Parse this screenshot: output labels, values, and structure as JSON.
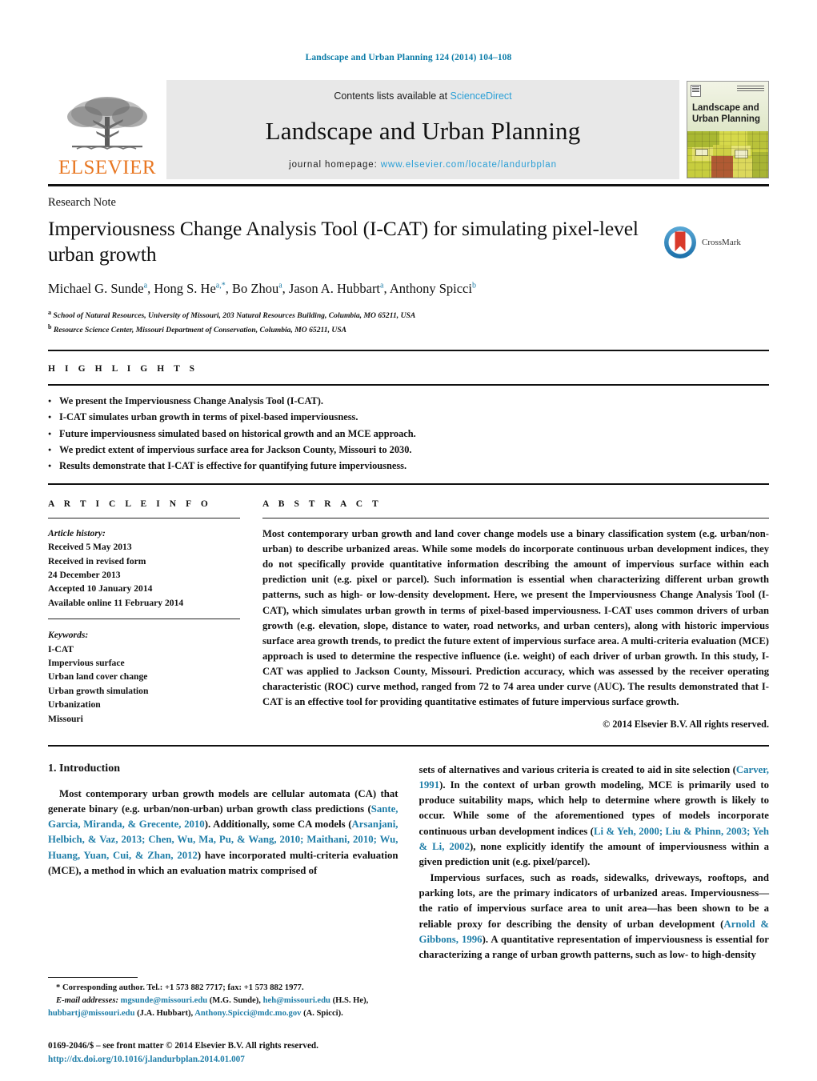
{
  "running_head": "Landscape and Urban Planning 124 (2014) 104–108",
  "masthead": {
    "elsevier_wordmark": "ELSEVIER",
    "contents_prefix": "Contents lists available at ",
    "contents_link": "ScienceDirect",
    "journal_title": "Landscape and Urban Planning",
    "homepage_prefix": "journal homepage: ",
    "homepage_url": "www.elsevier.com/locate/landurbplan",
    "cover_title_line1": "Landscape and",
    "cover_title_line2": "Urban Planning"
  },
  "article": {
    "doctype": "Research Note",
    "title": "Imperviousness Change Analysis Tool (I-CAT) for simulating pixel-level urban growth",
    "crossmark_label": "CrossMark",
    "authors": [
      {
        "name": "Michael G. Sunde",
        "marks": "a",
        "sep": ", "
      },
      {
        "name": "Hong S. He",
        "marks": "a,*",
        "sep": ", "
      },
      {
        "name": "Bo Zhou",
        "marks": "a",
        "sep": ", "
      },
      {
        "name": "Jason A. Hubbart",
        "marks": "a",
        "sep": ", "
      },
      {
        "name": "Anthony Spicci",
        "marks": "b",
        "sep": ""
      }
    ],
    "affiliations": [
      {
        "mark": "a",
        "text": "School of Natural Resources, University of Missouri, 203 Natural Resources Building, Columbia, MO 65211, USA"
      },
      {
        "mark": "b",
        "text": "Resource Science Center, Missouri Department of Conservation, Columbia, MO 65211, USA"
      }
    ]
  },
  "highlights": {
    "label": "H I G H L I G H T S",
    "items": [
      "We present the Imperviousness Change Analysis Tool (I-CAT).",
      "I-CAT simulates urban growth in terms of pixel-based imperviousness.",
      "Future imperviousness simulated based on historical growth and an MCE approach.",
      "We predict extent of impervious surface area for Jackson County, Missouri to 2030.",
      "Results demonstrate that I-CAT is effective for quantifying future imperviousness."
    ]
  },
  "article_info": {
    "label": "A R T I C L E    I N F O",
    "history_label": "Article history:",
    "history": [
      "Received 5 May 2013",
      "Received in revised form",
      "24 December 2013",
      "Accepted 10 January 2014",
      "Available online 11 February 2014"
    ],
    "keywords_label": "Keywords:",
    "keywords": [
      "I-CAT",
      "Impervious surface",
      "Urban land cover change",
      "Urban growth simulation",
      "Urbanization",
      "Missouri"
    ]
  },
  "abstract": {
    "label": "A B S T R A C T",
    "text": "Most contemporary urban growth and land cover change models use a binary classification system (e.g. urban/non-urban) to describe urbanized areas. While some models do incorporate continuous urban development indices, they do not specifically provide quantitative information describing the amount of impervious surface within each prediction unit (e.g. pixel or parcel). Such information is essential when characterizing different urban growth patterns, such as high- or low-density development. Here, we present the Imperviousness Change Analysis Tool (I-CAT), which simulates urban growth in terms of pixel-based imperviousness. I-CAT uses common drivers of urban growth (e.g. elevation, slope, distance to water, road networks, and urban centers), along with historic impervious surface area growth trends, to predict the future extent of impervious surface area. A multi-criteria evaluation (MCE) approach is used to determine the respective influence (i.e. weight) of each driver of urban growth. In this study, I-CAT was applied to Jackson County, Missouri. Prediction accuracy, which was assessed by the receiver operating characteristic (ROC) curve method, ranged from 72 to 74 area under curve (AUC). The results demonstrated that I-CAT is an effective tool for providing quantitative estimates of future impervious surface growth.",
    "copyright": "© 2014 Elsevier B.V. All rights reserved."
  },
  "intro": {
    "section_title": "1.  Introduction",
    "left_p1_a": "Most contemporary urban growth models are cellular automata (CA) that generate binary (e.g. urban/non-urban) urban growth class predictions (",
    "left_p1_cite1": "Sante, Garcia, Miranda, & Grecente, 2010",
    "left_p1_b": "). Additionally, some CA models (",
    "left_p1_cite2": "Arsanjani, Helbich, & Vaz, 2013; Chen, Wu, Ma, Pu, & Wang, 2010; Maithani, 2010; Wu, Huang, Yuan, Cui, & Zhan, 2012",
    "left_p1_c": ") have incorporated multi-criteria evaluation (MCE), a method in which an evaluation matrix comprised of",
    "right_p1_a": "sets of alternatives and various criteria is created to aid in site selection (",
    "right_p1_cite1": "Carver, 1991",
    "right_p1_b": "). In the context of urban growth modeling, MCE is primarily used to produce suitability maps, which help to determine where growth is likely to occur. While some of the aforementioned types of models incorporate continuous urban development indices (",
    "right_p1_cite2": "Li & Yeh, 2000; Liu & Phinn, 2003; Yeh & Li, 2002",
    "right_p1_c": "), none explicitly identify the amount of imperviousness within a given prediction unit (e.g. pixel/parcel).",
    "right_p2_a": "Impervious surfaces, such as roads, sidewalks, driveways, rooftops, and parking lots, are the primary indicators of urbanized areas. Imperviousness—the ratio of impervious surface area to unit area—has been shown to be a reliable proxy for describing the density of urban development (",
    "right_p2_cite1": "Arnold & Gibbons, 1996",
    "right_p2_b": "). A quantitative representation of imperviousness is essential for characterizing a range of urban growth patterns, such as low- to high-density"
  },
  "footnotes": {
    "corresponding": "* Corresponding author. Tel.: +1 573 882 7717; fax: +1 573 882 1977.",
    "email_label": "E-mail addresses:",
    "emails": [
      {
        "address": "mgsunde@missouri.edu",
        "owner": "(M.G. Sunde)"
      },
      {
        "address": "heh@missouri.edu",
        "owner": "(H.S. He)"
      },
      {
        "address": "hubbartj@missouri.edu",
        "owner": "(J.A. Hubbart)"
      },
      {
        "address": "Anthony.Spicci@mdc.mo.gov",
        "owner": "(A. Spicci)"
      }
    ],
    "imprint_line": "0169-2046/$ – see front matter © 2014 Elsevier B.V. All rights reserved.",
    "doi": "http://dx.doi.org/10.1016/j.landurbplan.2014.01.007"
  },
  "colors": {
    "link": "#1f7ea8",
    "sciencedirect": "#2a9fd6",
    "elsevier_orange": "#e87722",
    "running_head": "#0b7ca8"
  }
}
